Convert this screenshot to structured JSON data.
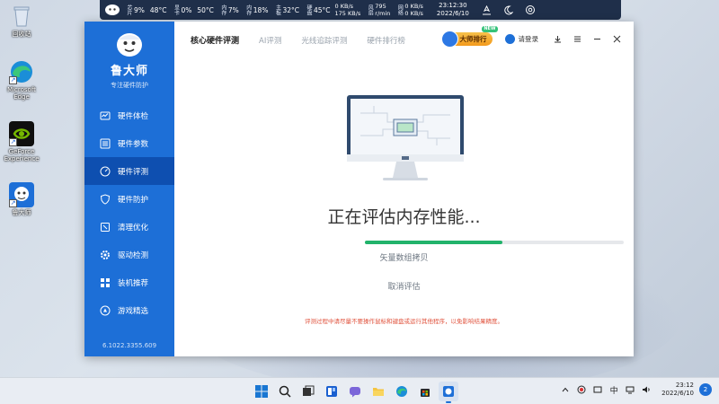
{
  "desktop": {
    "icons": [
      {
        "label": "回收站"
      },
      {
        "label": "Microsoft Edge"
      },
      {
        "label": "GeForce Experience"
      },
      {
        "label": "鲁大师"
      }
    ]
  },
  "monitor_bar": {
    "cpu": {
      "caption": "芯片",
      "usage": "9%",
      "temp": "48°C"
    },
    "gpu": {
      "caption": "显卡",
      "usage": "0%",
      "temp": "50°C"
    },
    "mem": {
      "caption": "内存",
      "usage": "7%"
    },
    "disk": {
      "caption": "内存",
      "usage": "18%"
    },
    "board": {
      "caption": "主板",
      "temp": "32°C"
    },
    "hdd": {
      "caption": "硬盘",
      "temp": "45°C"
    },
    "speed": {
      "up": "0 KB/s",
      "down": "175 KB/s"
    },
    "fan": {
      "caption": "风扇",
      "value": "795",
      "unit": "r/min"
    },
    "net": {
      "caption": "网络",
      "up": "0 KB/s",
      "down": "0 KB/s"
    },
    "time": "23:12:30",
    "date": "2022/6/10"
  },
  "app": {
    "brand_name": "鲁大师",
    "brand_slogan": "专注硬件防护",
    "nav": [
      {
        "label": "硬件体检",
        "icon": "checkup-icon"
      },
      {
        "label": "硬件参数",
        "icon": "params-icon"
      },
      {
        "label": "硬件评测",
        "icon": "gauge-icon",
        "active": true
      },
      {
        "label": "硬件防护",
        "icon": "shield-icon"
      },
      {
        "label": "清理优化",
        "icon": "broom-icon"
      },
      {
        "label": "驱动检测",
        "icon": "gear-icon"
      },
      {
        "label": "装机推荐",
        "icon": "puzzle-icon"
      },
      {
        "label": "游戏精选",
        "icon": "game-icon"
      }
    ],
    "version": "6.1022.3355.609",
    "tabs": [
      {
        "label": "核心硬件评测",
        "active": true
      },
      {
        "label": "AI评测"
      },
      {
        "label": "光线追踪评测"
      },
      {
        "label": "硬件排行榜"
      }
    ],
    "rank_badge": "大师排行",
    "rank_new": "NEW",
    "login": "请登录",
    "status": "正在评估内存性能...",
    "progress": 0.53,
    "sub_status": "矢量数组拷贝",
    "cancel": "取消评估",
    "notice": "评测过程中请尽量不要操作鼠标和键盘或运行其他程序，以免影响结果精度。"
  },
  "taskbar": {
    "ime": "中",
    "clock_time": "23:12",
    "clock_date": "2022/6/10",
    "notifications": "2"
  },
  "colors": {
    "sidebar": "#1d6fd7",
    "sidebar_active": "#0e4fb0",
    "progress": "#22b36b",
    "notice": "#e0523c"
  }
}
